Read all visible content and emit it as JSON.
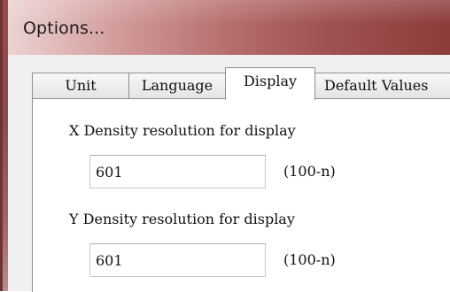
{
  "window": {
    "title": "Options..."
  },
  "tabs": [
    {
      "label": "Unit"
    },
    {
      "label": "Language"
    },
    {
      "label": "Display"
    },
    {
      "label": "Default Values"
    }
  ],
  "active_tab": "Display",
  "fields": [
    {
      "label": "X Density resolution for display",
      "value": "601",
      "hint": "(100-n)"
    },
    {
      "label": "Y Density resolution for display",
      "value": "601",
      "hint": "(100-n)"
    }
  ],
  "colors": {
    "title_bar_accent": "#8d3b3b",
    "dialog_bg": "#f0f0f0"
  }
}
